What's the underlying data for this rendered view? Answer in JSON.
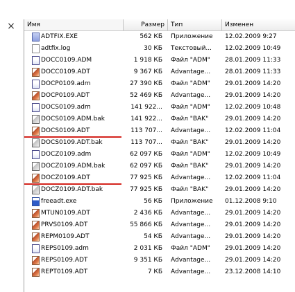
{
  "close_symbol": "×",
  "columns": {
    "name": "Имя",
    "size": "Размер",
    "type": "Тип",
    "modified": "Изменен"
  },
  "files": [
    {
      "icon": "exe",
      "name": "ADTFIX.EXE",
      "size": "562 КБ",
      "type": "Приложение",
      "modified": "12.02.2009 9:27"
    },
    {
      "icon": "log",
      "name": "adtfix.log",
      "size": "30 КБ",
      "type": "Текстовый...",
      "modified": "12.02.2009 10:49"
    },
    {
      "icon": "adm",
      "name": "DOCC0109.ADM",
      "size": "1 918 КБ",
      "type": "Файл \"ADM\"",
      "modified": "28.01.2009 11:33"
    },
    {
      "icon": "adt",
      "name": "DOCC0109.ADT",
      "size": "9 367 КБ",
      "type": "Advantage...",
      "modified": "28.01.2009 11:33"
    },
    {
      "icon": "adm",
      "name": "DOCP0109.adm",
      "size": "27 390 КБ",
      "type": "Файл \"ADM\"",
      "modified": "29.01.2009 14:20"
    },
    {
      "icon": "adt",
      "name": "DOCP0109.ADT",
      "size": "52 469 КБ",
      "type": "Advantage...",
      "modified": "29.01.2009 14:20"
    },
    {
      "icon": "adm",
      "name": "DOCS0109.adm",
      "size": "141 922...",
      "type": "Файл \"ADM\"",
      "modified": "12.02.2009 10:48"
    },
    {
      "icon": "bak",
      "name": "DOCS0109.ADM.bak",
      "size": "141 922...",
      "type": "Файл \"BAK\"",
      "modified": "29.01.2009 14:20"
    },
    {
      "icon": "adt",
      "name": "DOCS0109.ADT",
      "size": "113 707...",
      "type": "Advantage...",
      "modified": "12.02.2009 11:04"
    },
    {
      "icon": "bak",
      "name": "DOCS0109.ADT.bak",
      "size": "113 707...",
      "type": "Файл \"BAK\"",
      "modified": "29.01.2009 14:20"
    },
    {
      "icon": "adm",
      "name": "DOCZ0109.adm",
      "size": "62 097 КБ",
      "type": "Файл \"ADM\"",
      "modified": "12.02.2009 10:49"
    },
    {
      "icon": "bak",
      "name": "DOCZ0109.ADM.bak",
      "size": "62 097 КБ",
      "type": "Файл \"BAK\"",
      "modified": "29.01.2009 14:20"
    },
    {
      "icon": "adt",
      "name": "DOCZ0109.ADT",
      "size": "77 925 КБ",
      "type": "Advantage...",
      "modified": "12.02.2009 11:04"
    },
    {
      "icon": "bak",
      "name": "DOCZ0109.ADT.bak",
      "size": "77 925 КБ",
      "type": "Файл \"BAK\"",
      "modified": "29.01.2009 14:20"
    },
    {
      "icon": "app",
      "name": "freeadt.exe",
      "size": "56 КБ",
      "type": "Приложение",
      "modified": "01.12.2008 9:10"
    },
    {
      "icon": "adt",
      "name": "MTUN0109.ADT",
      "size": "2 436 КБ",
      "type": "Advantage...",
      "modified": "29.01.2009 14:20"
    },
    {
      "icon": "adt",
      "name": "PRVS0109.ADT",
      "size": "55 866 КБ",
      "type": "Advantage...",
      "modified": "29.01.2009 14:20"
    },
    {
      "icon": "adt",
      "name": "REPM0109.ADT",
      "size": "54 КБ",
      "type": "Advantage...",
      "modified": "29.01.2009 14:20"
    },
    {
      "icon": "adm",
      "name": "REPS0109.adm",
      "size": "2 031 КБ",
      "type": "Файл \"ADM\"",
      "modified": "29.01.2009 14:20"
    },
    {
      "icon": "adt",
      "name": "REPS0109.ADT",
      "size": "9 351 КБ",
      "type": "Advantage...",
      "modified": "29.01.2009 14:20"
    },
    {
      "icon": "adt",
      "name": "REPT0109.ADT",
      "size": "7 КБ",
      "type": "Advantage...",
      "modified": "23.12.2008 14:10"
    }
  ],
  "underlined_rows": [
    8,
    12
  ],
  "colors": {
    "underline": "#d4231c",
    "adt_icon": "#b84f2c"
  }
}
